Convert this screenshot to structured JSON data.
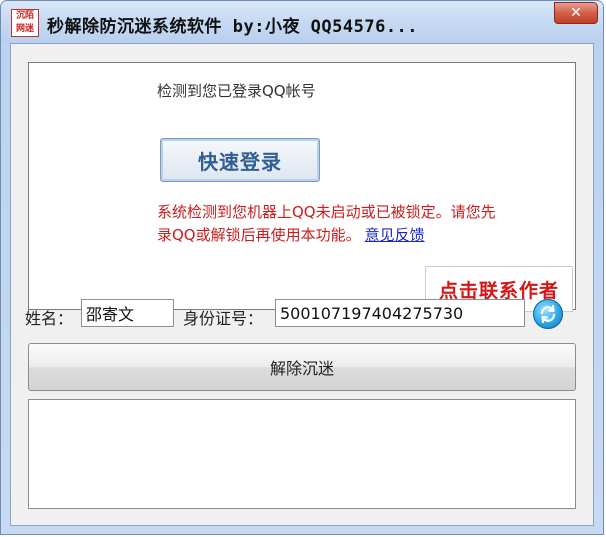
{
  "window": {
    "title": "秒解除防沉迷系统软件 by:小夜   QQ54576...",
    "icon_text": [
      "沉陌",
      "网迷"
    ],
    "close_label": "✕"
  },
  "panel": {
    "detected_text": "检测到您已登录QQ帐号",
    "quick_login_label": "快速登录",
    "warning_line1": "系统检测到您机器上QQ未启动或已被锁定。请您先",
    "warning_line2": "录QQ或解锁后再使用本功能。",
    "feedback_link": "意见反馈",
    "contact_label": "点击联系作者"
  },
  "form": {
    "name_label": "姓名：",
    "name_value": "邵寄文",
    "id_label": "身份证号：",
    "id_value": "500107197404275730",
    "refresh_icon": "refresh-icon"
  },
  "actions": {
    "unlock_label": "解除沉迷"
  },
  "log": {
    "lines": []
  },
  "colors": {
    "warning": "#c81d1d",
    "link": "#1a28c6",
    "contact": "#d71515",
    "title_bar": "#c2d7f1"
  }
}
